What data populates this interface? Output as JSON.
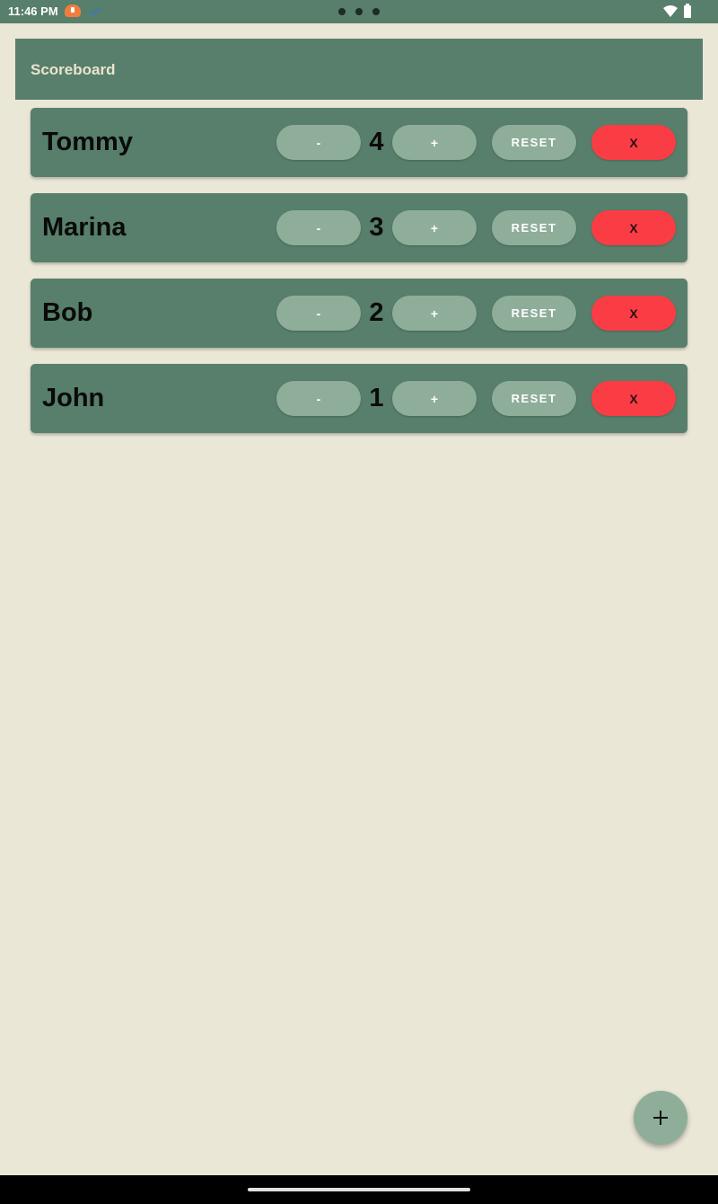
{
  "status_bar": {
    "time": "11:46 PM",
    "icons": [
      "download-notification-icon",
      "check-icon",
      "more-dots-icon",
      "wifi-icon",
      "battery-icon"
    ]
  },
  "app_bar": {
    "title": "Scoreboard"
  },
  "players": [
    {
      "name": "Tommy",
      "score": "4"
    },
    {
      "name": "Marina",
      "score": "3"
    },
    {
      "name": "Bob",
      "score": "2"
    },
    {
      "name": "John",
      "score": "1"
    }
  ],
  "controls": {
    "decrement_label": "-",
    "increment_label": "+",
    "reset_label": "RESET",
    "remove_label": "X"
  },
  "fab": {
    "icon": "plus-icon"
  },
  "colors": {
    "background": "#eae7d7",
    "primary": "#577f6b",
    "button": "#8eae9a",
    "remove_button": "#fa3d45",
    "title_text": "#eae4cf"
  }
}
